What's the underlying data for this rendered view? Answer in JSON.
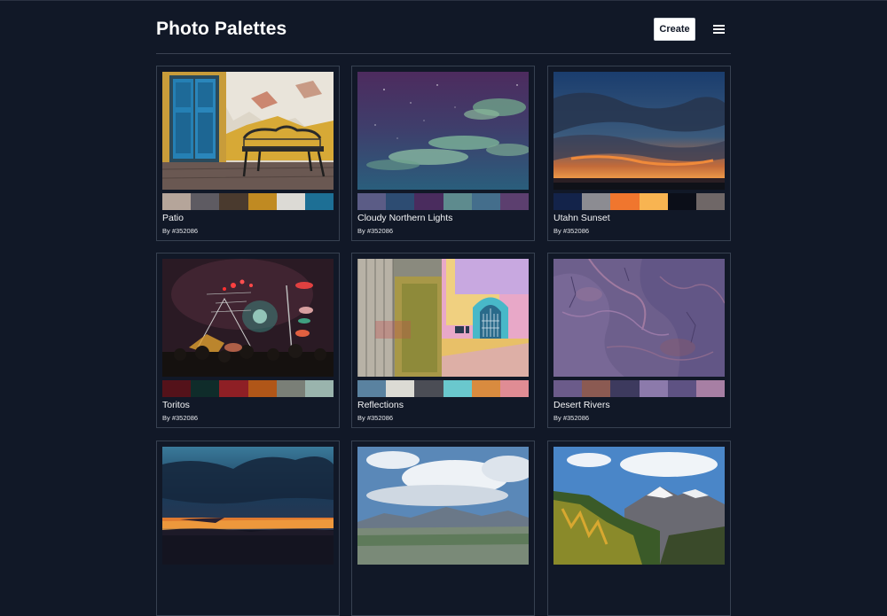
{
  "header": {
    "title": "Photo Palettes",
    "create_label": "Create",
    "menu_icon": "hamburger-menu-icon"
  },
  "cards": [
    {
      "title": "Patio",
      "author": "By #352086",
      "swatches": [
        "#b5a59a",
        "#5e5b62",
        "#4a3a2e",
        "#c08a22",
        "#dcdad5",
        "#1d6f95"
      ]
    },
    {
      "title": "Cloudy Northern Lights",
      "author": "By #352086",
      "swatches": [
        "#5b5c86",
        "#2d4c72",
        "#4a2c5e",
        "#5e8b8e",
        "#446e8c",
        "#5c3f6f"
      ]
    },
    {
      "title": "Utahn Sunset",
      "author": "By #352086",
      "swatches": [
        "#13234a",
        "#8c8c92",
        "#f0762e",
        "#f8b451",
        "#0b0e18",
        "#6f6767"
      ]
    },
    {
      "title": "Toritos",
      "author": "By #352086",
      "swatches": [
        "#54121a",
        "#0f2c2a",
        "#8e1f25",
        "#b05618",
        "#7a7f77",
        "#9ab4ad"
      ]
    },
    {
      "title": "Reflections",
      "author": "By #352086",
      "swatches": [
        "#5a82a0",
        "#dcdbd4",
        "#4b4d55",
        "#6ac8cd",
        "#d98b3f",
        "#e08c94"
      ]
    },
    {
      "title": "Desert Rivers",
      "author": "By #352086",
      "swatches": [
        "#6b5b8a",
        "#8b5a52",
        "#3d3a5e",
        "#8c7aab",
        "#5e5283",
        "#a77fa4"
      ]
    },
    {
      "title": "",
      "author": "",
      "swatches": []
    },
    {
      "title": "",
      "author": "",
      "swatches": []
    },
    {
      "title": "",
      "author": "",
      "swatches": []
    }
  ]
}
